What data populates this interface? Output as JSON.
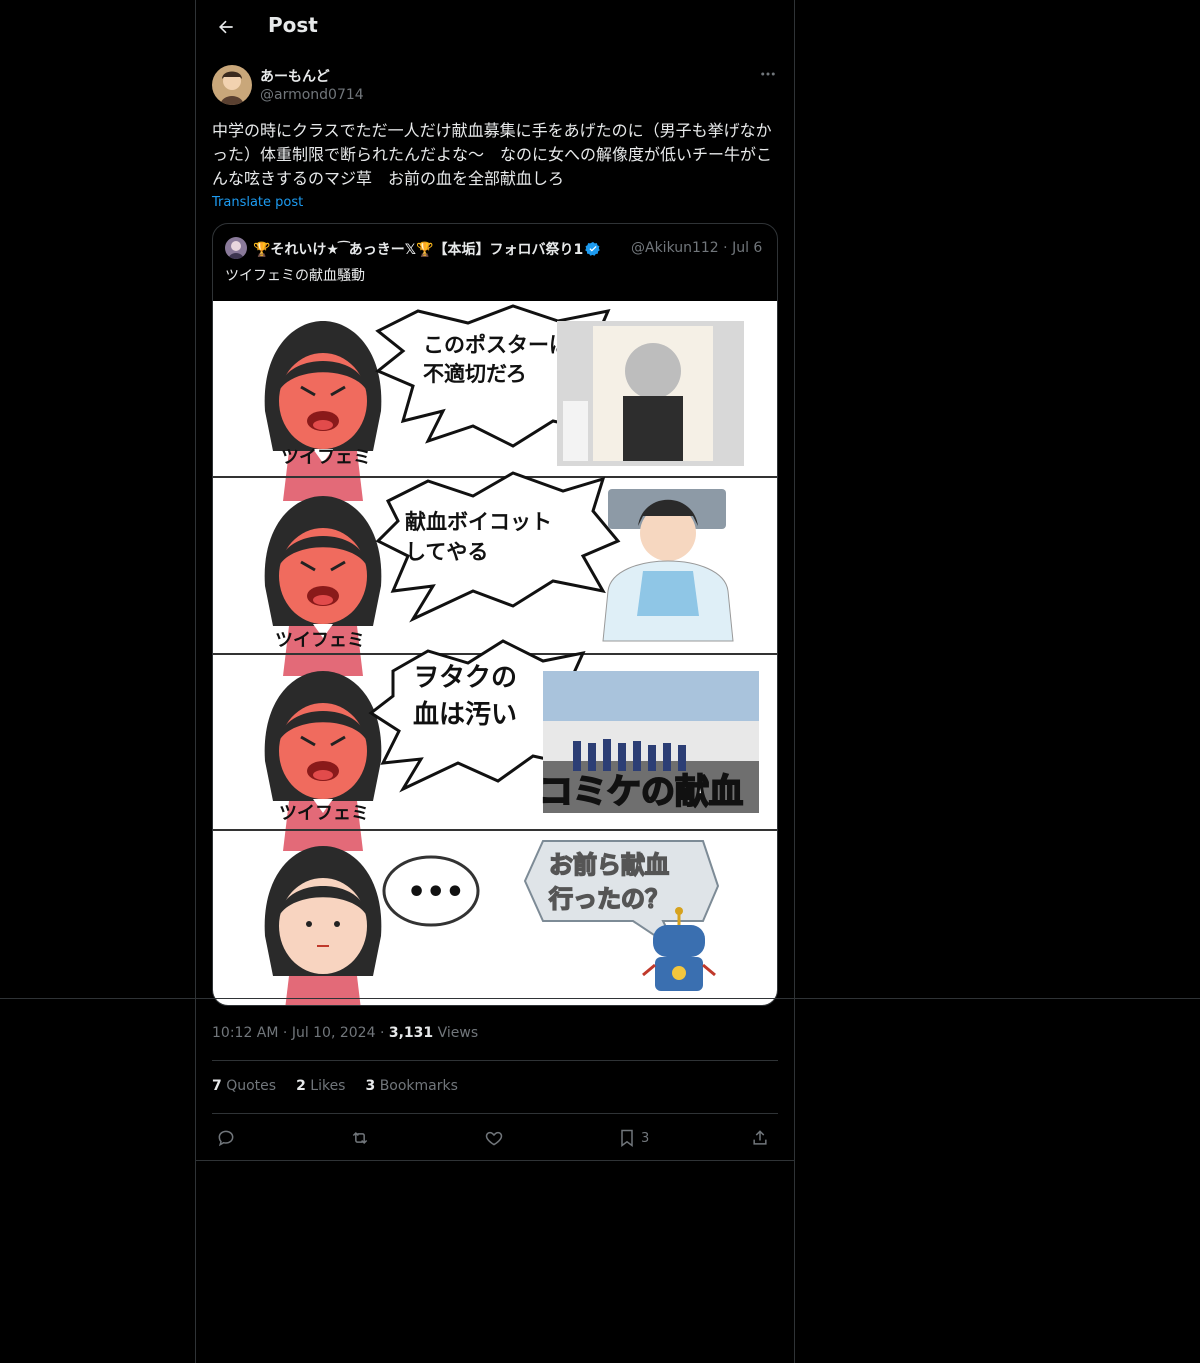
{
  "header": {
    "title": "Post"
  },
  "author": {
    "name": "あーもんど",
    "handle": "@armond0714"
  },
  "post": {
    "text": "中学の時にクラスでただ一人だけ献血募集に手をあげたのに（男子も挙げなかった）体重制限で断られたんだよな〜　なのに女への解像度が低いチー牛がこんな呟きするのマジ草　お前の血を全部献血しろ",
    "translate_label": "Translate post"
  },
  "quote": {
    "name": "🏆それいけ★ ͡ あっきー𝕏🏆【本垢】フォロバ祭り1",
    "handle": "@Akikun112",
    "date": "Jul 6",
    "text": "ツイフェミの献血騒動",
    "image": {
      "panel1_bubble": "このポスターは\n不適切だろ",
      "panel2_bubble": "献血ボイコット\nしてやる",
      "panel3_bubble": "ヲタクの\n血は汚い",
      "panel3_caption": "コミケの献血",
      "panel4_bubble": "•••",
      "panel4_robot_bubble": "お前ら献血\n行ったの？",
      "character_label": "ツイフェミ"
    }
  },
  "meta": {
    "time": "10:12 AM",
    "date": "Jul 10, 2024",
    "views_count": "3,131",
    "views_label": "Views"
  },
  "stats": {
    "quotes_count": "7",
    "quotes_label": "Quotes",
    "likes_count": "2",
    "likes_label": "Likes",
    "bookmarks_count": "3",
    "bookmarks_label": "Bookmarks"
  },
  "actions": {
    "bookmark_count": "3"
  },
  "colors": {
    "background": "#000000",
    "border": "#2f3336",
    "text": "#e7e9ea",
    "muted": "#71767b",
    "link": "#1d9bf0"
  }
}
